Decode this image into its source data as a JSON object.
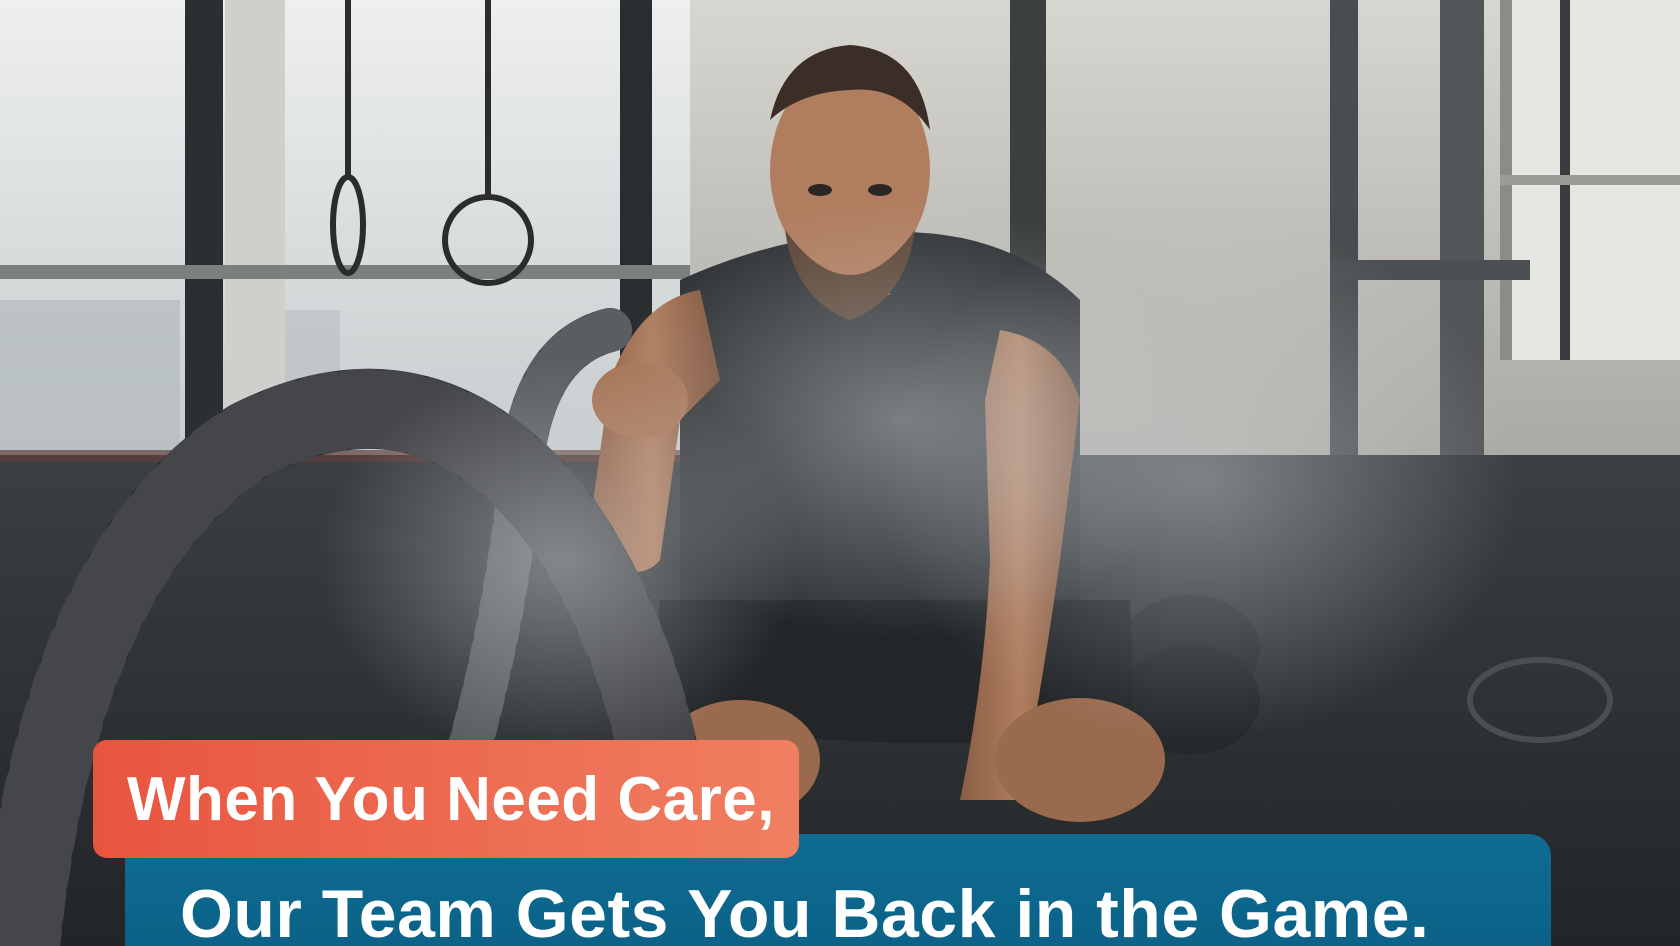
{
  "banner": {
    "line1": "When You Need Care,",
    "line2": "Our Team Gets You Back in the Game."
  },
  "colors": {
    "line1_background": "#ee6a50",
    "line2_background": "#0d6790",
    "text": "#ffffff"
  },
  "photo": {
    "subject": "man-with-battle-ropes-in-gym"
  }
}
